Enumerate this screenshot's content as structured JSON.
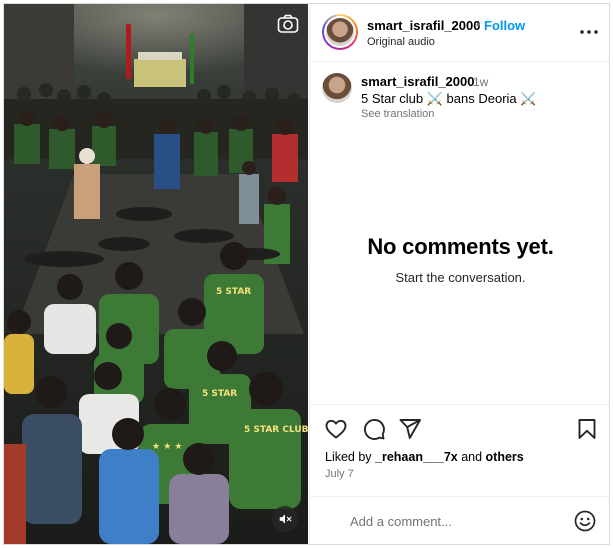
{
  "header": {
    "username": "smart_israfil_2000",
    "separator": "•",
    "follow_label": "Follow",
    "audio_label": "Original audio"
  },
  "caption": {
    "username": "smart_israfil_2000",
    "time_ago": "1w",
    "text": "5 Star club ⚔️ bans Deoria ⚔️",
    "see_translation": "See translation"
  },
  "comments": {
    "empty_title": "No comments yet.",
    "empty_subtitle": "Start the conversation."
  },
  "likes": {
    "prefix": "Liked by ",
    "user": "_rehaan___7x",
    "middle": " and ",
    "others": "others"
  },
  "post_date": "July 7",
  "comment_box": {
    "placeholder": "Add a comment..."
  },
  "icons": {
    "camera": "camera-icon",
    "mute": "audio-muted-icon",
    "more": "more-options-icon",
    "like": "heart-icon",
    "comment": "comment-icon",
    "share": "send-icon",
    "save": "bookmark-icon",
    "emoji": "emoji-icon"
  },
  "colors": {
    "follow": "#0095f6",
    "muted_text": "#737373",
    "jersey_green": "#2f6b2a"
  }
}
